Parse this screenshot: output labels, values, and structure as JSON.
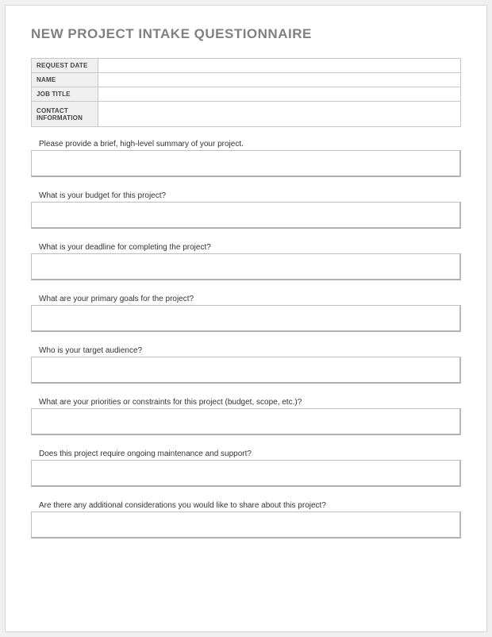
{
  "title": "NEW PROJECT INTAKE QUESTIONNAIRE",
  "info_rows": [
    {
      "label": "REQUEST DATE",
      "value": "",
      "tall": false
    },
    {
      "label": "NAME",
      "value": "",
      "tall": false
    },
    {
      "label": "JOB TITLE",
      "value": "",
      "tall": false
    },
    {
      "label": "CONTACT INFORMATION",
      "value": "",
      "tall": true
    }
  ],
  "questions": [
    {
      "label": "Please provide a brief, high-level summary of your project.",
      "value": ""
    },
    {
      "label": "What is your budget for this project?",
      "value": ""
    },
    {
      "label": "What is your deadline for completing the project?",
      "value": ""
    },
    {
      "label": "What are your primary goals for the project?",
      "value": ""
    },
    {
      "label": "Who is your target audience?",
      "value": ""
    },
    {
      "label": "What are your priorities or constraints for this project (budget, scope, etc.)?",
      "value": ""
    },
    {
      "label": "Does this project require ongoing maintenance and support?",
      "value": ""
    },
    {
      "label": "Are there any additional considerations you would like to share about this project?",
      "value": ""
    }
  ]
}
